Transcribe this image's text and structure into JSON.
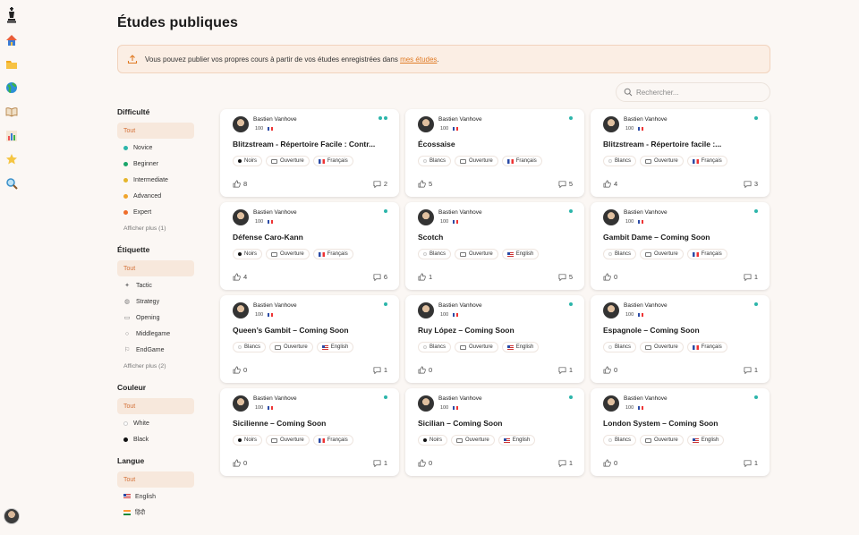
{
  "header": {
    "title": "Études publiques"
  },
  "banner": {
    "text": "Vous pouvez publier vos propres cours à partir de vos études enregistrées dans ",
    "link": "mes études",
    "suffix": "."
  },
  "search": {
    "placeholder": "Rechercher..."
  },
  "colors": {
    "accent": "#e07b25",
    "teal": "#2cb5aa",
    "novice": "#2cb5aa",
    "beginner": "#1aa56a",
    "intermediate": "#e5b52b",
    "advanced": "#f0a42b",
    "expert": "#ef6d2a"
  },
  "rail": {
    "icons": [
      "chess-king-icon",
      "home-icon",
      "folder-icon",
      "globe-icon",
      "book-icon",
      "chart-icon",
      "star-icon",
      "search-icon"
    ]
  },
  "filters": {
    "difficulty": {
      "title": "Difficulté",
      "all": "Tout",
      "options": [
        "Novice",
        "Beginner",
        "Intermediate",
        "Advanced",
        "Expert"
      ],
      "more": "Afficher plus (1)"
    },
    "tag": {
      "title": "Étiquette",
      "all": "Tout",
      "options": [
        "Tactic",
        "Strategy",
        "Opening",
        "Middlegame",
        "EndGame"
      ],
      "more": "Afficher plus (2)"
    },
    "color": {
      "title": "Couleur",
      "all": "Tout",
      "options": [
        "White",
        "Black"
      ]
    },
    "language": {
      "title": "Langue",
      "all": "Tout",
      "options": [
        "English",
        "हिंदी"
      ]
    }
  },
  "cards": [
    {
      "author": "Bastien Vanhove",
      "rating": "100",
      "title": "Blitzstream - Répertoire Facile : Contr...",
      "color": "Noirs",
      "colorKind": "black",
      "type": "Ouverture",
      "lang": "Français",
      "langKind": "fr",
      "likes": "8",
      "comments": "2",
      "dots": 2
    },
    {
      "author": "Bastien Vanhove",
      "rating": "100",
      "title": "Écossaise",
      "color": "Blancs",
      "colorKind": "white",
      "type": "Ouverture",
      "lang": "Français",
      "langKind": "fr",
      "likes": "5",
      "comments": "5",
      "dots": 1
    },
    {
      "author": "Bastien Vanhove",
      "rating": "100",
      "title": "Blitzstream - Répertoire facile :...",
      "color": "Blancs",
      "colorKind": "white",
      "type": "Ouverture",
      "lang": "Français",
      "langKind": "fr",
      "likes": "4",
      "comments": "3",
      "dots": 1
    },
    {
      "author": "Bastien Vanhove",
      "rating": "100",
      "title": "Défense Caro-Kann",
      "color": "Noirs",
      "colorKind": "black",
      "type": "Ouverture",
      "lang": "Français",
      "langKind": "fr",
      "likes": "4",
      "comments": "6",
      "dots": 1
    },
    {
      "author": "Bastien Vanhove",
      "rating": "100",
      "title": "Scotch",
      "color": "Blancs",
      "colorKind": "white",
      "type": "Ouverture",
      "lang": "English",
      "langKind": "us",
      "likes": "1",
      "comments": "5",
      "dots": 1
    },
    {
      "author": "Bastien Vanhove",
      "rating": "100",
      "title": "Gambit Dame – Coming Soon",
      "color": "Blancs",
      "colorKind": "white",
      "type": "Ouverture",
      "lang": "Français",
      "langKind": "fr",
      "likes": "0",
      "comments": "1",
      "dots": 1
    },
    {
      "author": "Bastien Vanhove",
      "rating": "100",
      "title": "Queen’s Gambit – Coming Soon",
      "color": "Blancs",
      "colorKind": "white",
      "type": "Ouverture",
      "lang": "English",
      "langKind": "us",
      "likes": "0",
      "comments": "1",
      "dots": 1
    },
    {
      "author": "Bastien Vanhove",
      "rating": "100",
      "title": "Ruy López – Coming Soon",
      "color": "Blancs",
      "colorKind": "white",
      "type": "Ouverture",
      "lang": "English",
      "langKind": "us",
      "likes": "0",
      "comments": "1",
      "dots": 1
    },
    {
      "author": "Bastien Vanhove",
      "rating": "100",
      "title": "Espagnole – Coming Soon",
      "color": "Blancs",
      "colorKind": "white",
      "type": "Ouverture",
      "lang": "Français",
      "langKind": "fr",
      "likes": "0",
      "comments": "1",
      "dots": 1
    },
    {
      "author": "Bastien Vanhove",
      "rating": "100",
      "title": "Sicilienne – Coming Soon",
      "color": "Noirs",
      "colorKind": "black",
      "type": "Ouverture",
      "lang": "Français",
      "langKind": "fr",
      "likes": "0",
      "comments": "1",
      "dots": 1
    },
    {
      "author": "Bastien Vanhove",
      "rating": "100",
      "title": "Sicilian – Coming Soon",
      "color": "Noirs",
      "colorKind": "black",
      "type": "Ouverture",
      "lang": "English",
      "langKind": "us",
      "likes": "0",
      "comments": "1",
      "dots": 1
    },
    {
      "author": "Bastien Vanhove",
      "rating": "100",
      "title": "London System – Coming Soon",
      "color": "Blancs",
      "colorKind": "white",
      "type": "Ouverture",
      "lang": "English",
      "langKind": "us",
      "likes": "0",
      "comments": "1",
      "dots": 1
    }
  ]
}
